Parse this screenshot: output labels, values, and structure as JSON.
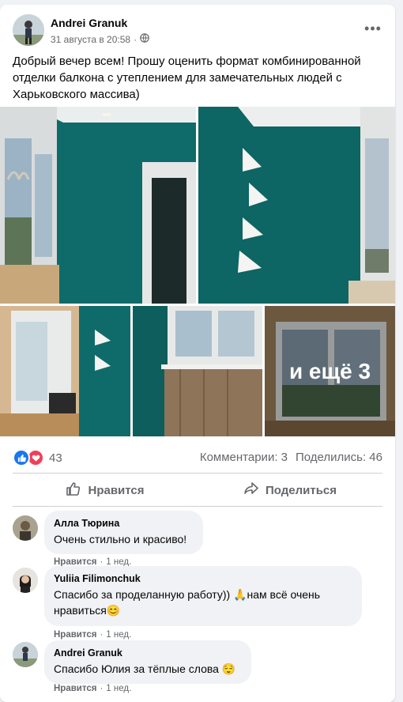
{
  "post": {
    "author": "Andrei Granuk",
    "timestamp": "31 августа в 20:58",
    "separator": "·",
    "more_glyph": "•••",
    "text": "Добрый вечер всем! Прошу оценить формат комбинированной отделки балкона с утеплением для замечательных людей с Харьковского массива)",
    "more_photos_label": "и ещё 3"
  },
  "stats": {
    "reaction_count": "43",
    "comments": "Комментарии: 3",
    "shares": "Поделились: 46"
  },
  "actions": {
    "like": "Нравится",
    "share": "Поделиться"
  },
  "comments": [
    {
      "author": "Алла Тюрина",
      "text": "Очень стильно и красиво!",
      "like": "Нравится",
      "dot": "·",
      "time": "1 нед."
    },
    {
      "author": "Yuliia Filimonchuk",
      "text": "Спасибо за проделанную работу)) 🙏нам всё очень нравиться😊",
      "like": "Нравится",
      "dot": "·",
      "time": "1 нед."
    },
    {
      "author": "Andrei Granuk",
      "text": "Спасибо Юлия за тёплые слова 😌",
      "like": "Нравится",
      "dot": "·",
      "time": "1 нед."
    }
  ],
  "colors": {
    "accent": "#1877f2",
    "love": "#f33e58",
    "wall_teal": "#0f6b6a",
    "secondary_text": "#65676b"
  }
}
